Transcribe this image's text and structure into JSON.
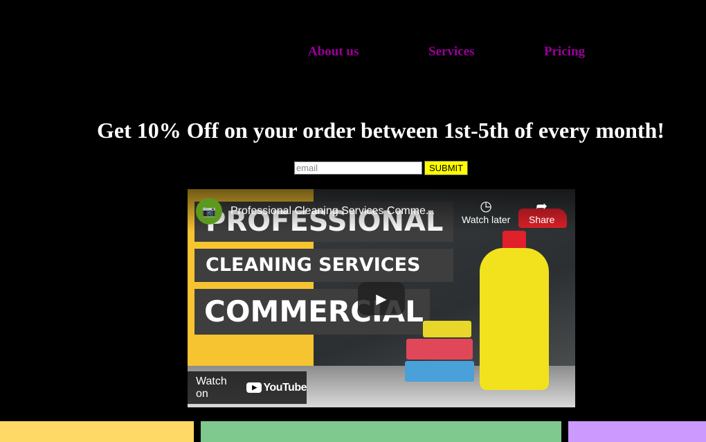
{
  "nav": {
    "items": [
      {
        "label": "About us"
      },
      {
        "label": "Services"
      },
      {
        "label": "Pricing"
      }
    ]
  },
  "promo": {
    "headline": "Get 10% Off on your order between 1st-5th of every month!",
    "email_placeholder": "email",
    "submit_label": "SUBMIT"
  },
  "video": {
    "title": "Professional Cleaning Services Comme...",
    "watch_later_label": "Watch later",
    "share_label": "Share",
    "watch_on_label": "Watch on",
    "youtube_label": "YouTube",
    "thumbnail_text": [
      "PROFESSIONAL",
      "CLEANING SERVICES",
      "COMMERCIAL"
    ]
  },
  "colors": {
    "background": "#000000",
    "nav_link": "#990099",
    "submit_bg": "#ffff00",
    "strip_1": "#ffd966",
    "strip_2": "#7fc98f",
    "strip_3": "#cc99ff"
  }
}
